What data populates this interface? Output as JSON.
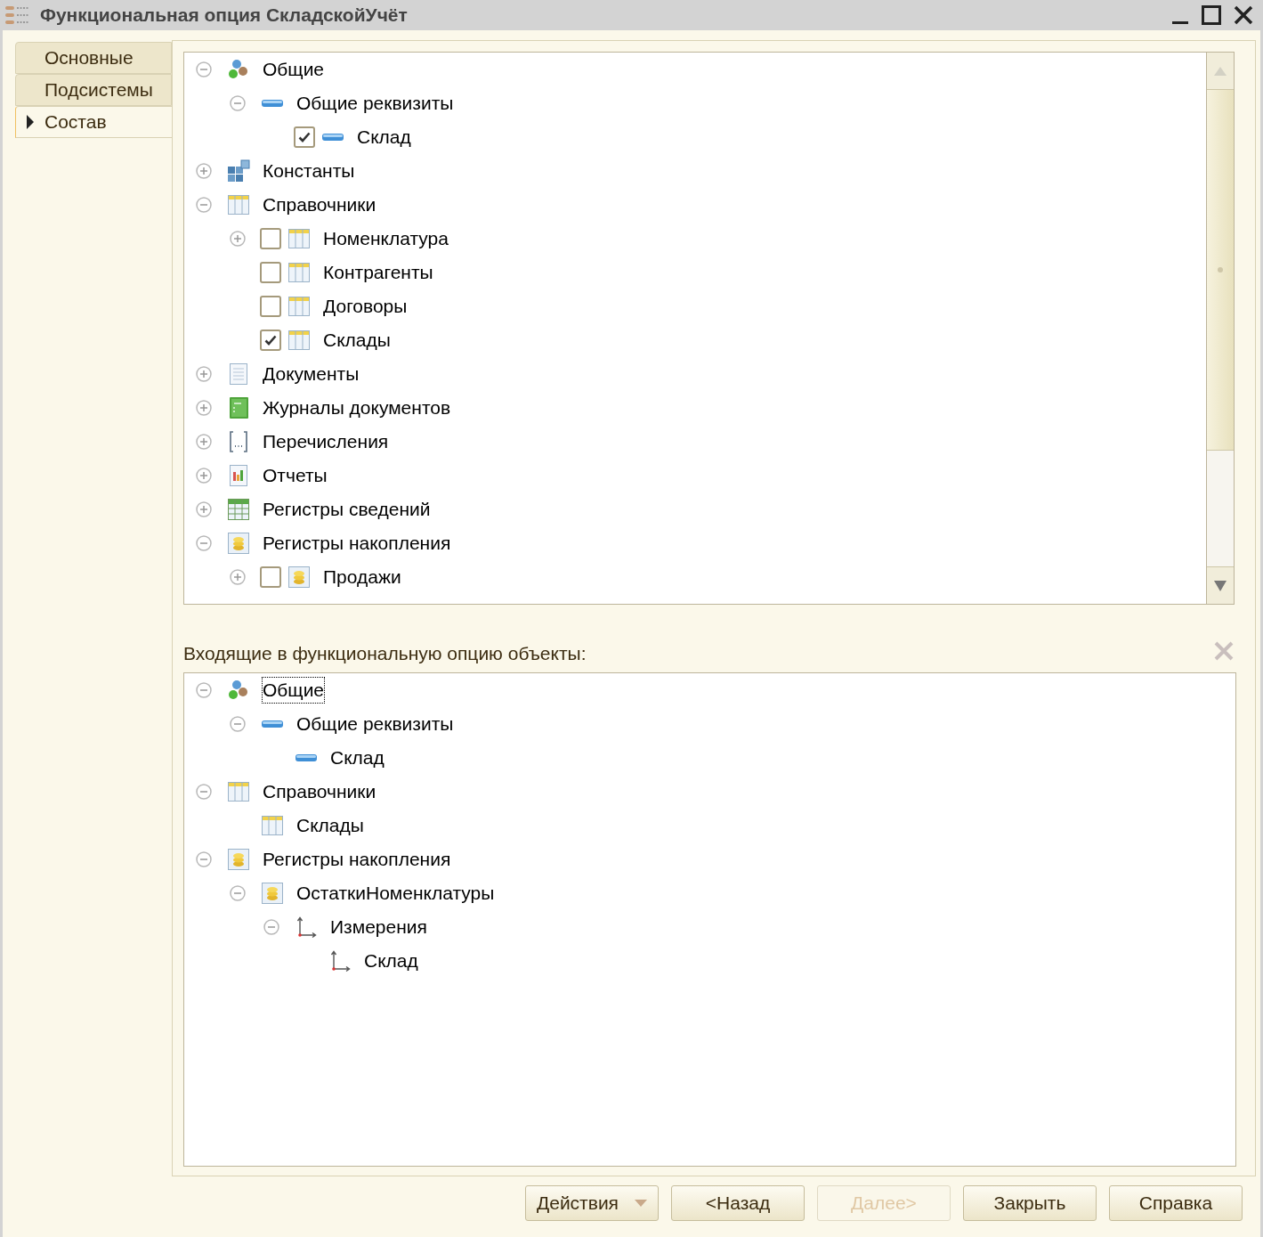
{
  "window": {
    "title": "Функциональная опция СкладскойУчёт"
  },
  "tabs": [
    {
      "label": "Основные",
      "selected": false
    },
    {
      "label": "Подсистемы",
      "selected": false
    },
    {
      "label": "Состав",
      "selected": true
    }
  ],
  "available_tree": [
    {
      "kind": "common",
      "label": "Общие",
      "expanded": true,
      "children": [
        {
          "kind": "attribute",
          "label": "Общие реквизиты",
          "expanded": true,
          "children": [
            {
              "kind": "attribute",
              "label": "Склад",
              "checked": true
            }
          ]
        }
      ]
    },
    {
      "kind": "constants",
      "label": "Константы",
      "expanded": false
    },
    {
      "kind": "catalog",
      "label": "Справочники",
      "expanded": true,
      "children": [
        {
          "kind": "catalog",
          "label": "Номенклатура",
          "expanded": false,
          "checked": false
        },
        {
          "kind": "catalog",
          "label": "Контрагенты",
          "checked": false
        },
        {
          "kind": "catalog",
          "label": "Договоры",
          "checked": false
        },
        {
          "kind": "catalog",
          "label": "Склады",
          "checked": true
        }
      ]
    },
    {
      "kind": "document",
      "label": "Документы",
      "expanded": false
    },
    {
      "kind": "journal",
      "label": "Журналы документов",
      "expanded": false
    },
    {
      "kind": "enum",
      "label": "Перечисления",
      "expanded": false
    },
    {
      "kind": "report",
      "label": "Отчеты",
      "expanded": false
    },
    {
      "kind": "info_register",
      "label": "Регистры сведений",
      "expanded": false
    },
    {
      "kind": "accum_register",
      "label": "Регистры накопления",
      "expanded": true,
      "children": [
        {
          "kind": "accum_register",
          "label": "Продажи",
          "expanded": false,
          "checked": false
        }
      ]
    }
  ],
  "included_label": "Входящие в функциональную опцию объекты:",
  "included_tree": [
    {
      "kind": "common",
      "label": "Общие",
      "expanded": true,
      "focused": true,
      "children": [
        {
          "kind": "attribute",
          "label": "Общие реквизиты",
          "expanded": true,
          "focused": false,
          "children": [
            {
              "kind": "attribute",
              "label": "Склад",
              "focused": false
            }
          ]
        }
      ]
    },
    {
      "kind": "catalog",
      "label": "Справочники",
      "expanded": true,
      "focused": false,
      "children": [
        {
          "kind": "catalog",
          "label": "Склады",
          "focused": false
        }
      ]
    },
    {
      "kind": "accum_register",
      "label": "Регистры накопления",
      "expanded": true,
      "focused": false,
      "children": [
        {
          "kind": "accum_register",
          "label": "ОстаткиНоменклатуры",
          "expanded": true,
          "focused": false,
          "children": [
            {
              "kind": "dimension",
              "label": "Измерения",
              "expanded": true,
              "focused": false,
              "children": [
                {
                  "kind": "dimension",
                  "label": "Склад",
                  "focused": false
                }
              ]
            }
          ]
        }
      ]
    }
  ],
  "buttons": [
    {
      "label": "Действия",
      "kind": "menu",
      "disabled": false
    },
    {
      "label": "<Назад",
      "kind": "plain",
      "disabled": false
    },
    {
      "label": "Далее>",
      "kind": "plain",
      "disabled": true
    },
    {
      "label": "Закрыть",
      "kind": "plain",
      "disabled": false
    },
    {
      "label": "Справка",
      "kind": "plain",
      "disabled": false
    }
  ]
}
